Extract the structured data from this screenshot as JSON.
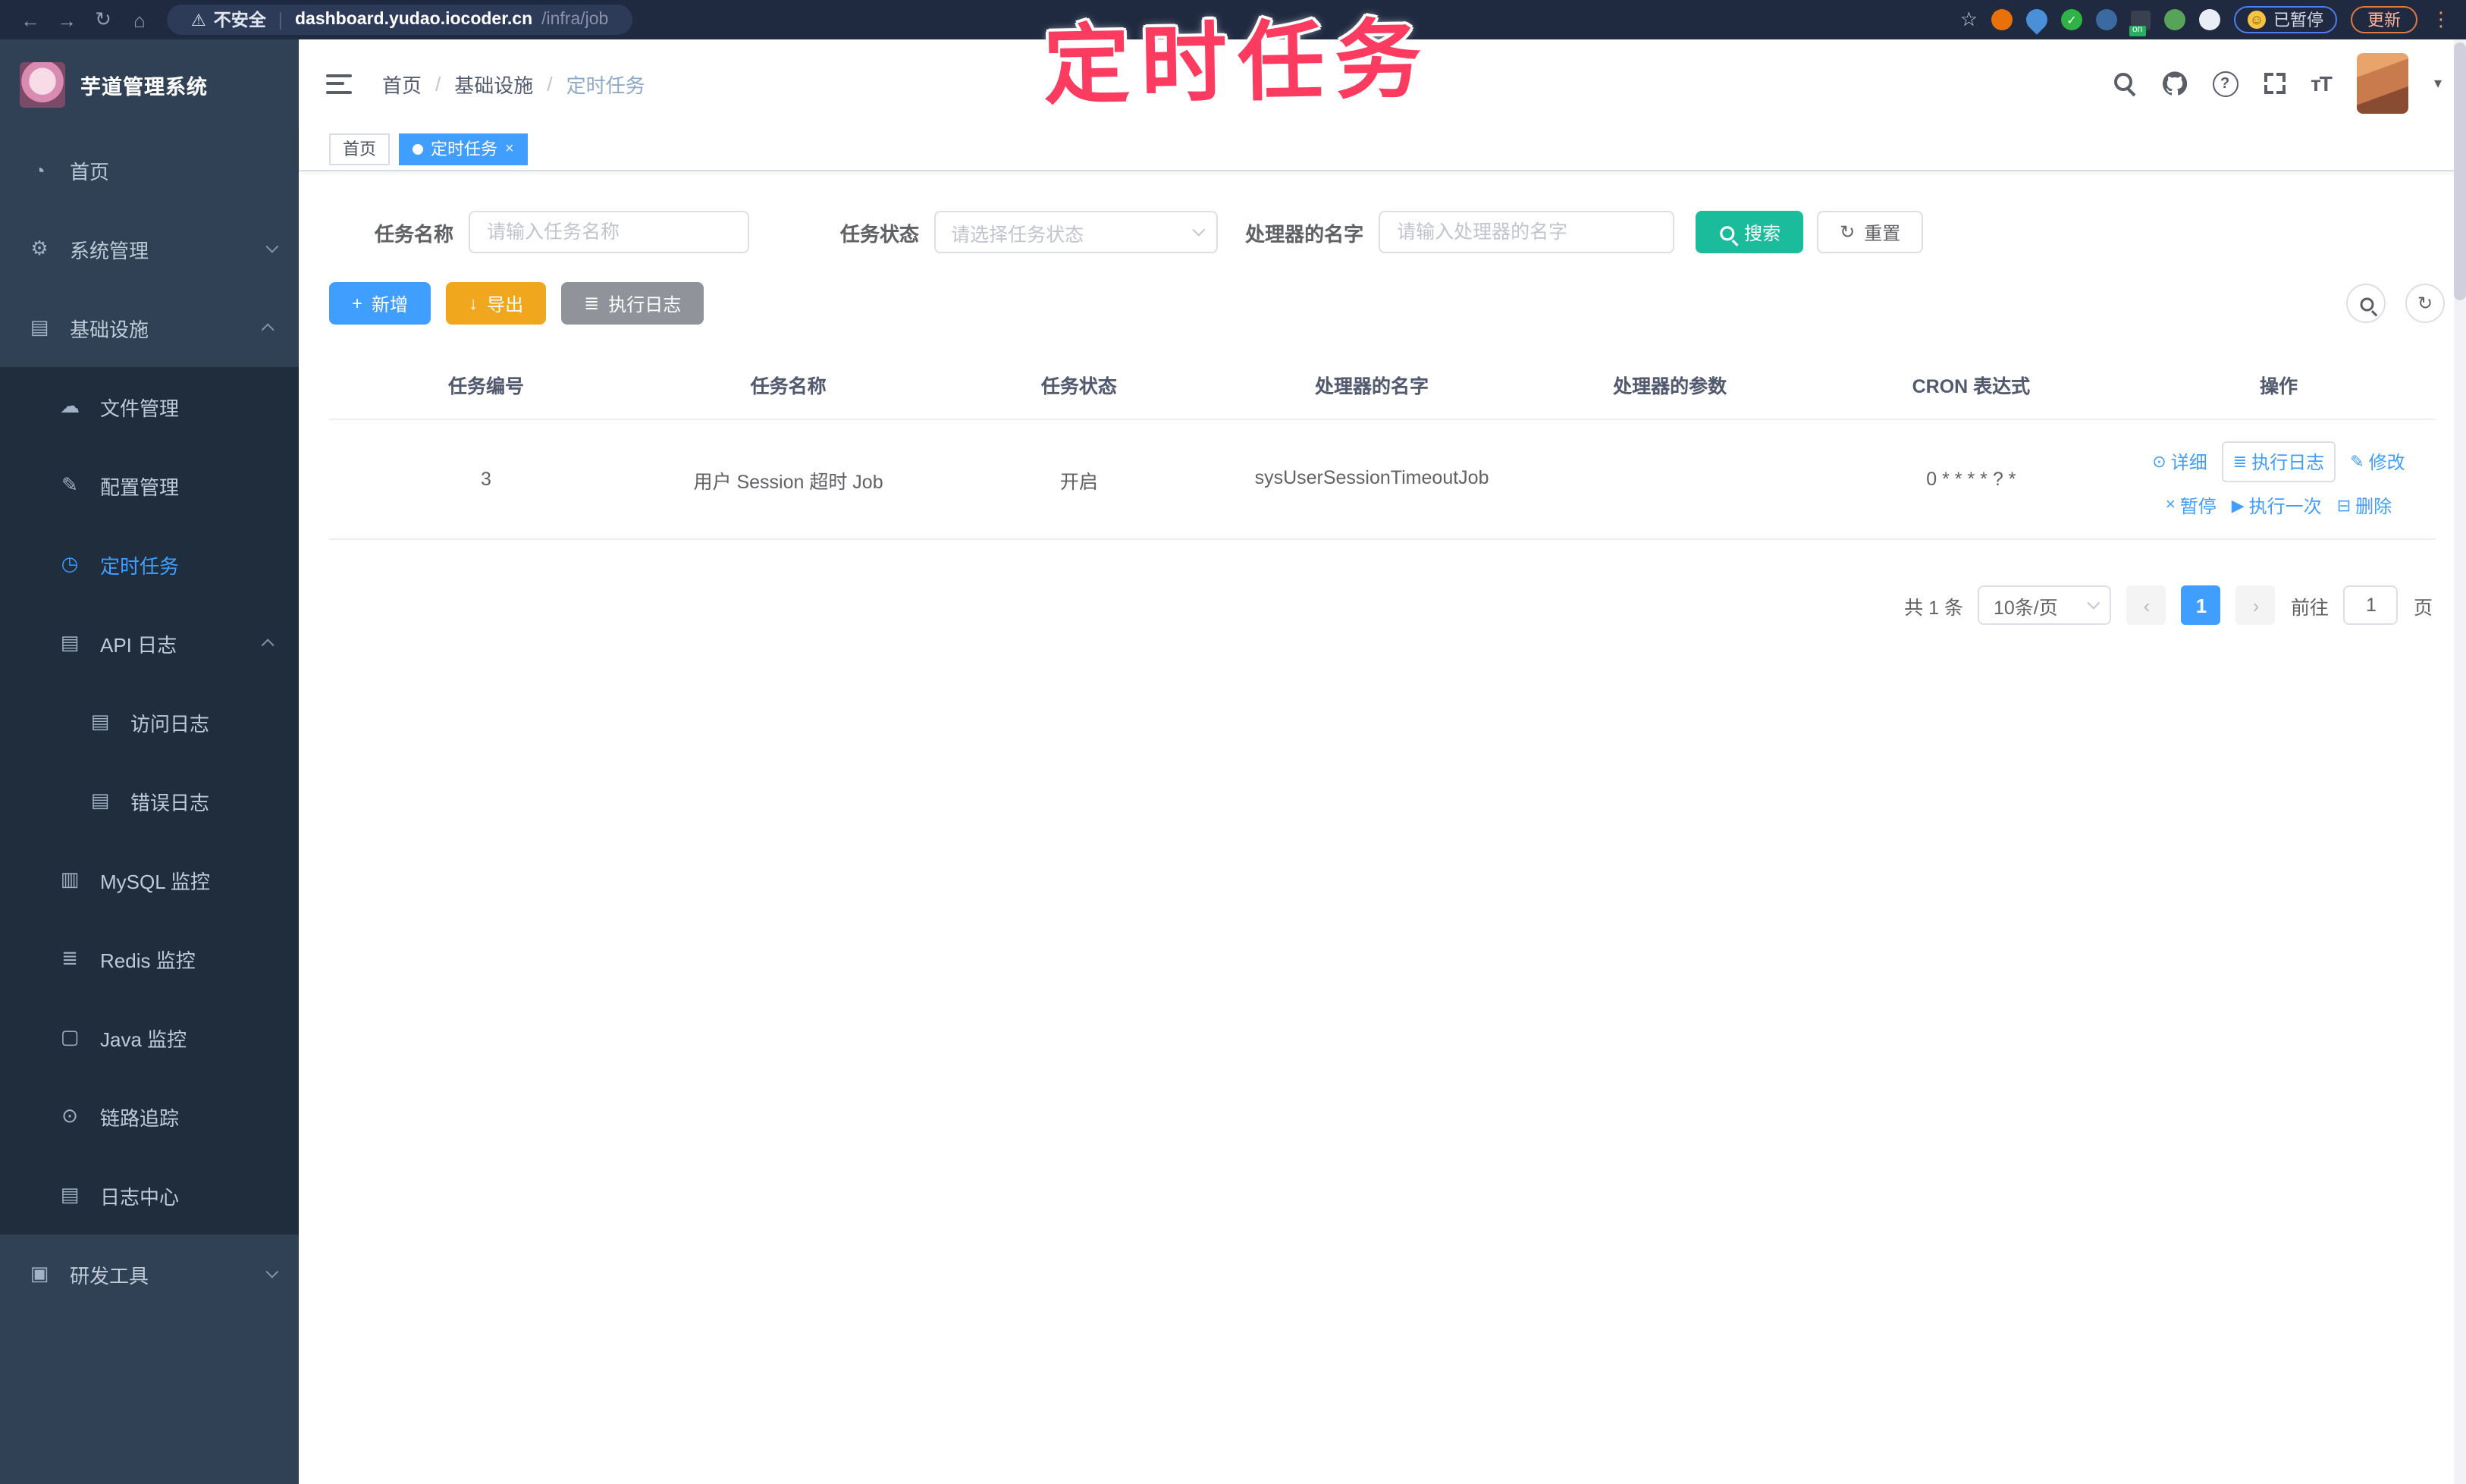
{
  "colors": {
    "accent": "#409EFF",
    "sidebar_bg": "#304156",
    "submenu_bg": "#1f2d3d",
    "warning_button": "#F0A71E",
    "info_button": "#909399",
    "search_button": "#1ABC9C",
    "overlay_pink": "#FB3B5F",
    "active_tab": "#409EFF"
  },
  "browser": {
    "security_label": "不安全",
    "url_host": "dashboard.yudao.iocoder.cn",
    "url_path": "/infra/job",
    "paused_badge": "已暂停",
    "update_button": "更新",
    "ext_on_badge": "on"
  },
  "overlay": {
    "title": "定时任务"
  },
  "sidebar": {
    "logo_title": "芋道管理系统",
    "items": [
      {
        "label": "首页"
      },
      {
        "label": "系统管理"
      },
      {
        "label": "基础设施"
      },
      {
        "label": "文件管理"
      },
      {
        "label": "配置管理"
      },
      {
        "label": "定时任务"
      },
      {
        "label": "API 日志"
      },
      {
        "label": "访问日志"
      },
      {
        "label": "错误日志"
      },
      {
        "label": "MySQL 监控"
      },
      {
        "label": "Redis 监控"
      },
      {
        "label": "Java 监控"
      },
      {
        "label": "链路追踪"
      },
      {
        "label": "日志中心"
      },
      {
        "label": "研发工具"
      }
    ]
  },
  "header": {
    "breadcrumb": [
      "首页",
      "基础设施",
      "定时任务"
    ],
    "separator": "/"
  },
  "tabs": [
    {
      "label": "首页"
    },
    {
      "label": "定时任务"
    }
  ],
  "filters": {
    "name_label": "任务名称",
    "name_placeholder": "请输入任务名称",
    "status_label": "任务状态",
    "status_placeholder": "请选择任务状态",
    "handler_label": "处理器的名字",
    "handler_placeholder": "请输入处理器的名字",
    "search_button": "搜索",
    "reset_button": "重置"
  },
  "toolbar": {
    "add_button": "新增",
    "export_button": "导出",
    "exec_log_button": "执行日志"
  },
  "table": {
    "headers": [
      "任务编号",
      "任务名称",
      "任务状态",
      "处理器的名字",
      "处理器的参数",
      "CRON 表达式",
      "操作"
    ],
    "rows": [
      {
        "id": "3",
        "name": "用户 Session 超时 Job",
        "status": "开启",
        "handler": "sysUserSessionTimeoutJob",
        "param": "",
        "cron": "0 * * * * ? *"
      }
    ],
    "ops": [
      {
        "label": "详细"
      },
      {
        "label": "执行日志"
      },
      {
        "label": "修改"
      },
      {
        "label": "暂停"
      },
      {
        "label": "执行一次"
      },
      {
        "label": "删除"
      }
    ]
  },
  "pagination": {
    "total": "共 1 条",
    "page_size": "10条/页",
    "page": "1",
    "goto_label": "前往",
    "goto_value": "1",
    "page_unit": "页"
  },
  "icons": {
    "back": "←",
    "forward": "→",
    "reload": "↻",
    "home": "⌂",
    "warning": "⚠",
    "star": "☆",
    "dots": "⋮",
    "smiley": "☺",
    "check": "✓",
    "question": "?",
    "fontsize": "тT",
    "caret": "▾",
    "close": "×",
    "menu_home": "◔",
    "menu_gear": "⚙",
    "menu_infra": "▤",
    "menu_cloud": "☁",
    "menu_edit": "✎",
    "menu_timer": "◷",
    "menu_doc": "▤",
    "menu_db": "▥",
    "menu_layers": "≣",
    "menu_monitor": "▢",
    "menu_eye": "⊙",
    "menu_tools": "▣",
    "plus": "+",
    "download": "↓",
    "list": "≣",
    "refresh": "↻",
    "op_detail": "⊙",
    "op_log": "≣",
    "op_edit": "✎",
    "op_pause": "×",
    "op_run": "▶",
    "op_delete": "⊟"
  }
}
